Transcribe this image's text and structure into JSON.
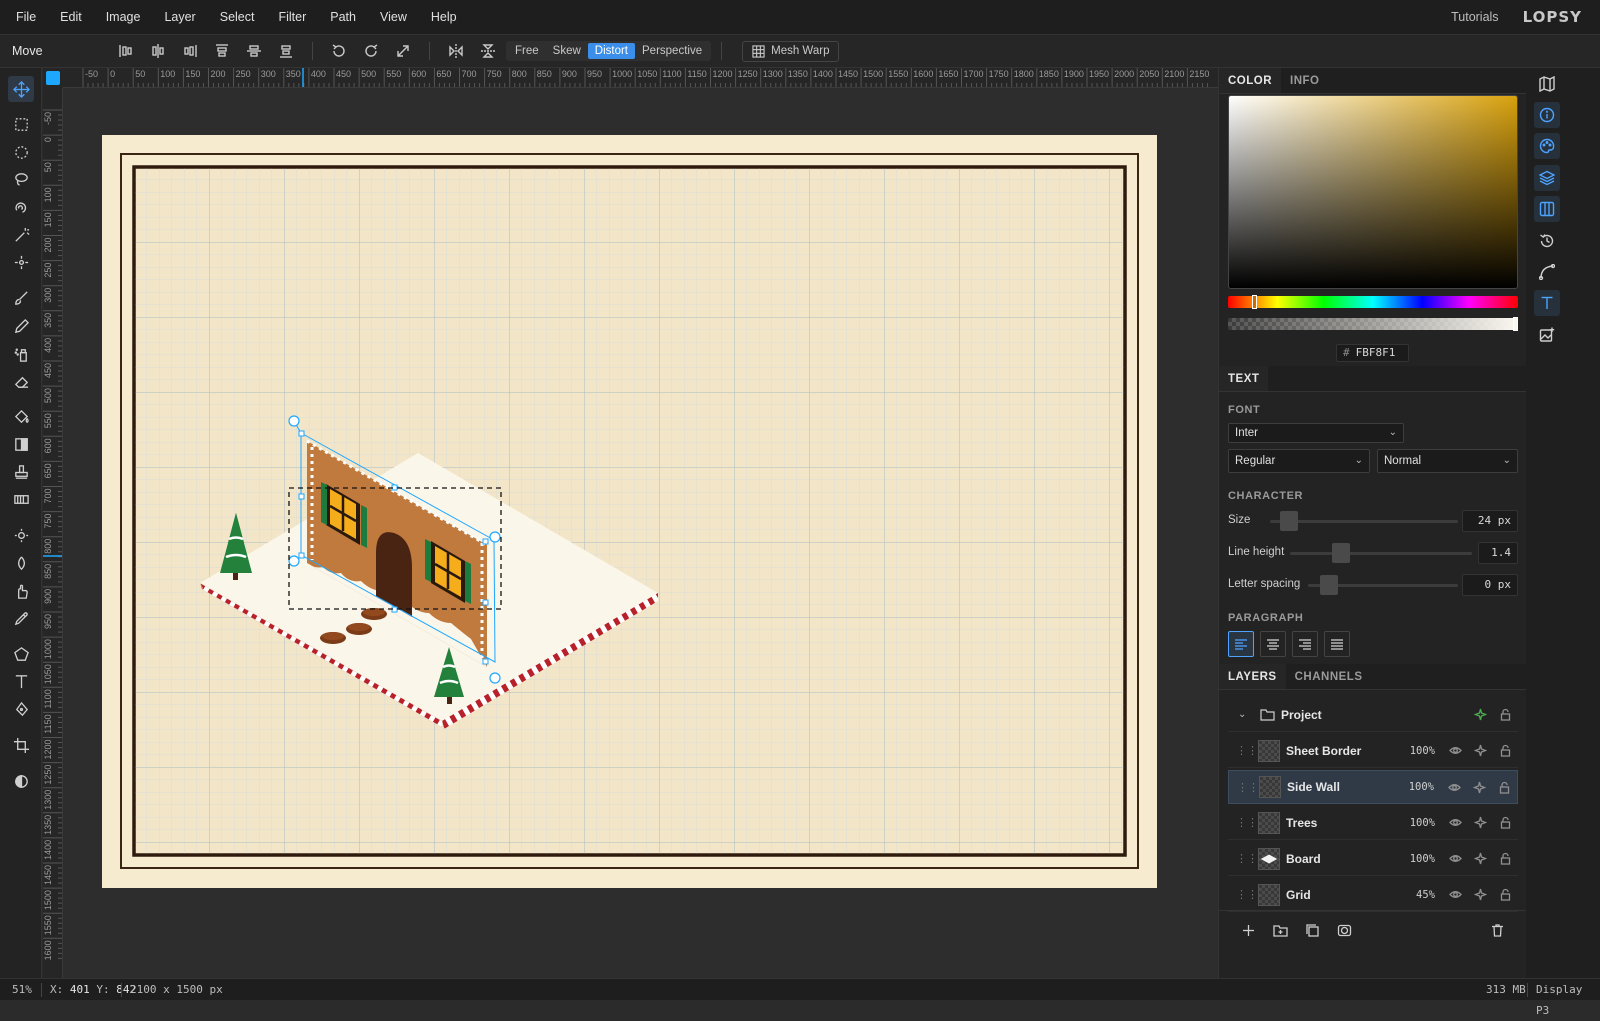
{
  "menubar": {
    "items": [
      "File",
      "Edit",
      "Image",
      "Layer",
      "Select",
      "Filter",
      "Path",
      "View",
      "Help"
    ],
    "tutorials": "Tutorials",
    "logo": "LOPSY"
  },
  "options": {
    "tool_name": "Move",
    "align_icons": [
      "align-left-icon",
      "align-center-h-icon",
      "align-right-icon",
      "align-top-icon",
      "align-middle-v-icon",
      "align-bottom-icon"
    ],
    "transform_modes": [
      "Free",
      "Skew",
      "Distort",
      "Perspective"
    ],
    "active_mode": "Distort",
    "mesh_warp": "Mesh Warp"
  },
  "rulers": {
    "h_labels": [
      "-50",
      "0",
      "50",
      "100",
      "150",
      "200",
      "250",
      "300",
      "350",
      "400",
      "450",
      "500",
      "550",
      "600",
      "650",
      "700",
      "750",
      "800",
      "850",
      "900",
      "950",
      "1000",
      "1050",
      "1100",
      "1150",
      "1200",
      "1250",
      "1300",
      "1350",
      "1400",
      "1450",
      "1500",
      "1550",
      "1600",
      "1650",
      "1700",
      "1750",
      "1800",
      "1850",
      "1900",
      "1950",
      "2000",
      "2050",
      "2100",
      "2150"
    ],
    "v_labels": [
      "-50",
      "0",
      "50",
      "100",
      "150",
      "200",
      "250",
      "300",
      "350",
      "400",
      "450",
      "500",
      "550",
      "600",
      "650",
      "700",
      "750",
      "800",
      "850",
      "900",
      "950",
      "1000",
      "1050",
      "1100",
      "1150",
      "1200",
      "1250",
      "1300",
      "1350",
      "1400",
      "1450",
      "1500",
      "1550",
      "1600"
    ]
  },
  "panels": {
    "color_tabs": [
      "COLOR",
      "INFO"
    ],
    "hex_value": "FBF8F1",
    "text_tab": "TEXT",
    "font_label": "FONT",
    "font_family": "Inter",
    "font_weight": "Regular",
    "font_style": "Normal",
    "character_label": "CHARACTER",
    "size_label": "Size",
    "size_value": "24 px",
    "line_height_label": "Line height",
    "line_height_value": "1.4",
    "letter_spacing_label": "Letter spacing",
    "letter_spacing_value": "0 px",
    "paragraph_label": "PARAGRAPH",
    "layers_tabs": [
      "LAYERS",
      "CHANNELS"
    ],
    "group_name": "Project",
    "layers": [
      {
        "name": "Sheet Border",
        "opacity": "100%"
      },
      {
        "name": "Side Wall",
        "opacity": "100%"
      },
      {
        "name": "Trees",
        "opacity": "100%"
      },
      {
        "name": "Board",
        "opacity": "100%"
      },
      {
        "name": "Grid",
        "opacity": "45%"
      }
    ]
  },
  "status": {
    "zoom": "51%",
    "x_label": "X:",
    "x": "401",
    "y_label": "Y:",
    "y": "842",
    "doc_size": "2100 x 1500 px",
    "memory": "313 MB",
    "color_profile": "Display P3"
  },
  "colors": {
    "accent": "#3b8eea",
    "artboard": "#f6ebce",
    "selected_color": "#FBF8F1"
  }
}
